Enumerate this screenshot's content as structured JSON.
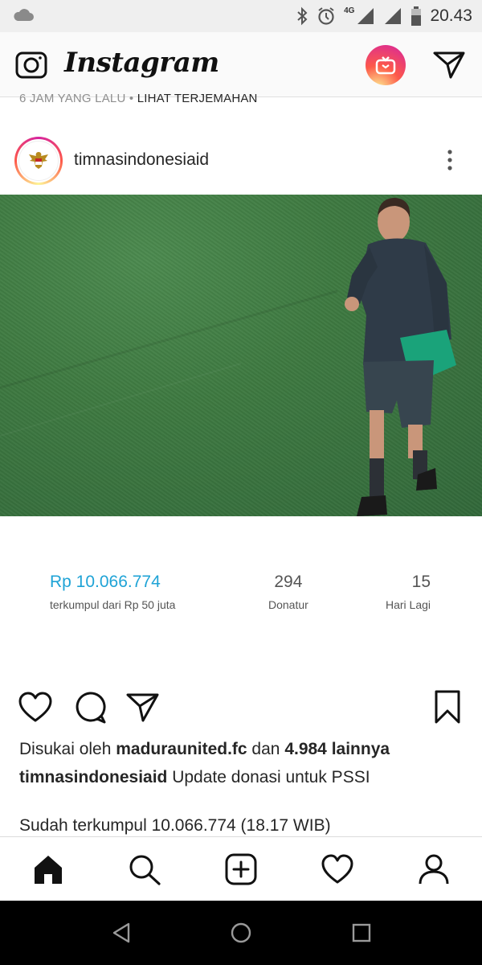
{
  "status_bar": {
    "time": "20.43",
    "network": "4G",
    "icons": [
      "cloud-icon",
      "bluetooth-icon",
      "alarm-icon",
      "signal-icon",
      "battery-icon"
    ]
  },
  "app_bar": {
    "logo": "Instagram",
    "icons": [
      "camera-icon",
      "igtv-icon",
      "direct-message-icon"
    ],
    "accent_gradient": [
      "#fdf497",
      "#fd5949",
      "#d6249f"
    ]
  },
  "previous_post_meta": {
    "time_ago": "6 JAM YANG LALU",
    "separator": " • ",
    "translate_link": "LIHAT TERJEMAHAN"
  },
  "post": {
    "username": "timnasindonesiaid",
    "donation": {
      "amount": "Rp 10.066.774",
      "amount_label": "terkumpul dari Rp 50 juta",
      "donors": "294",
      "donors_label": "Donatur",
      "days": "15",
      "days_label": "Hari Lagi",
      "accent_color": "#1fa3d6"
    },
    "likes": {
      "prefix": "Disukai oleh ",
      "user": "maduraunited.fc",
      "middle": " dan ",
      "others": "4.984 lainnya"
    },
    "caption": {
      "user": "timnasindonesiaid",
      "text": " Update donasi untuk PSSI",
      "line2": "Sudah terkumpul 10.066.774 (18.17 WIB)"
    }
  },
  "tab_bar": {
    "items": [
      "home-icon",
      "search-icon",
      "new-post-icon",
      "activity-heart-icon",
      "profile-icon"
    ]
  },
  "nav_bar": {
    "items": [
      "back-icon",
      "home-circle-icon",
      "recents-icon"
    ]
  }
}
